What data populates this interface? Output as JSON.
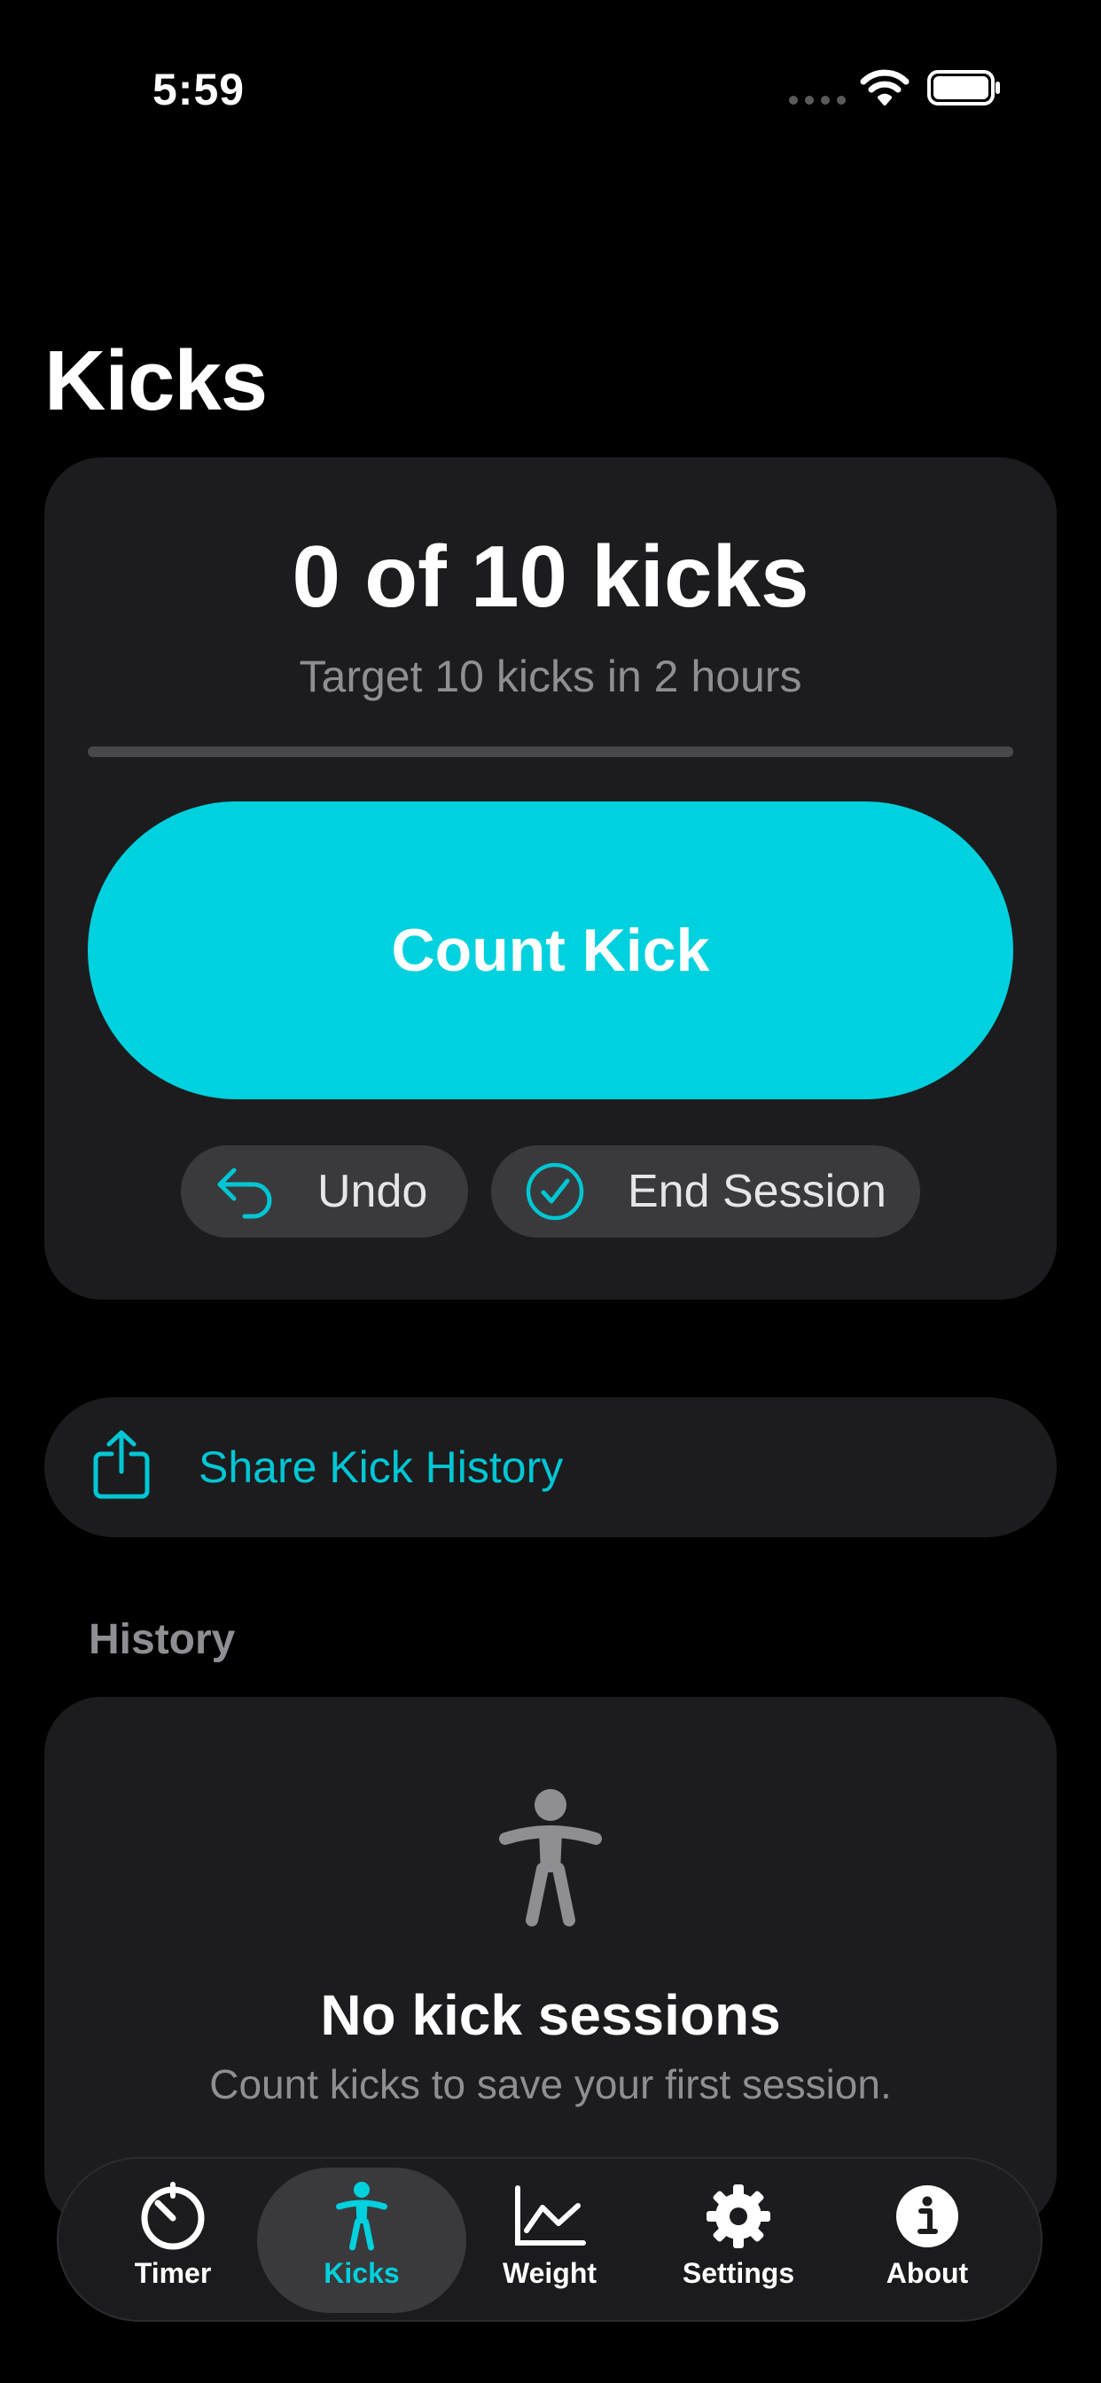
{
  "status_bar": {
    "time": "5:59"
  },
  "page_title": "Kicks",
  "session": {
    "count_title": "0 of 10 kicks",
    "target_text": "Target 10 kicks in 2 hours",
    "progress": 0,
    "count_button_label": "Count Kick",
    "undo_label": "Undo",
    "end_session_label": "End Session"
  },
  "share": {
    "label": "Share Kick History"
  },
  "history": {
    "header": "History",
    "empty_title": "No kick sessions",
    "empty_subtitle": "Count kicks to save your first session."
  },
  "tabbar": {
    "tabs": [
      {
        "label": "Timer",
        "icon": "timer-icon"
      },
      {
        "label": "Kicks",
        "icon": "figure-icon",
        "active": true
      },
      {
        "label": "Weight",
        "icon": "chart-line-icon"
      },
      {
        "label": "Settings",
        "icon": "gear-icon"
      },
      {
        "label": "About",
        "icon": "info-icon"
      }
    ]
  },
  "colors": {
    "accent": "#00d1de",
    "background": "#000000",
    "card": "#1c1c1e",
    "secondary_text": "#8e8e93"
  }
}
